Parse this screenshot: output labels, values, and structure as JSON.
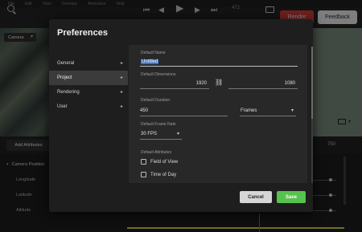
{
  "app": {
    "menu": [
      "File",
      "Edit",
      "View",
      "Overlays",
      "Animation",
      "Help"
    ],
    "frame_number": "472",
    "render_label": "Render",
    "feedback_label": "Feedback",
    "camera_label": "Camera",
    "add_attributes_label": "Add Attributes",
    "ruler_label": "750",
    "attribute_group": "Camera Position",
    "attributes": [
      "Longitude",
      "Latitude",
      "Altitude"
    ],
    "colors": {
      "render": "#c1393a",
      "timeline": "#c4bd3c",
      "cursor": "#d23a3a"
    }
  },
  "dialog": {
    "title": "Preferences",
    "nav": [
      {
        "label": "General",
        "active": false
      },
      {
        "label": "Project",
        "active": true
      },
      {
        "label": "Rendering",
        "active": false
      },
      {
        "label": "User",
        "active": false
      }
    ],
    "default_name": {
      "label": "Default Name",
      "value": "Untitled"
    },
    "dimensions": {
      "label": "Default Dimensions",
      "width": "1920",
      "height": "1080"
    },
    "duration": {
      "label": "Default Duration",
      "value": "450",
      "unit": "Frames"
    },
    "frame_rate": {
      "label": "Default Frame Rate",
      "value": "30 FPS"
    },
    "attributes": {
      "label": "Default Attributes",
      "options": [
        {
          "label": "Field of View",
          "checked": false
        },
        {
          "label": "Time of Day",
          "checked": false
        }
      ]
    },
    "cancel_label": "Cancel",
    "save_label": "Save",
    "colors": {
      "save": "#58c24e",
      "selection": "#4171c4"
    }
  }
}
